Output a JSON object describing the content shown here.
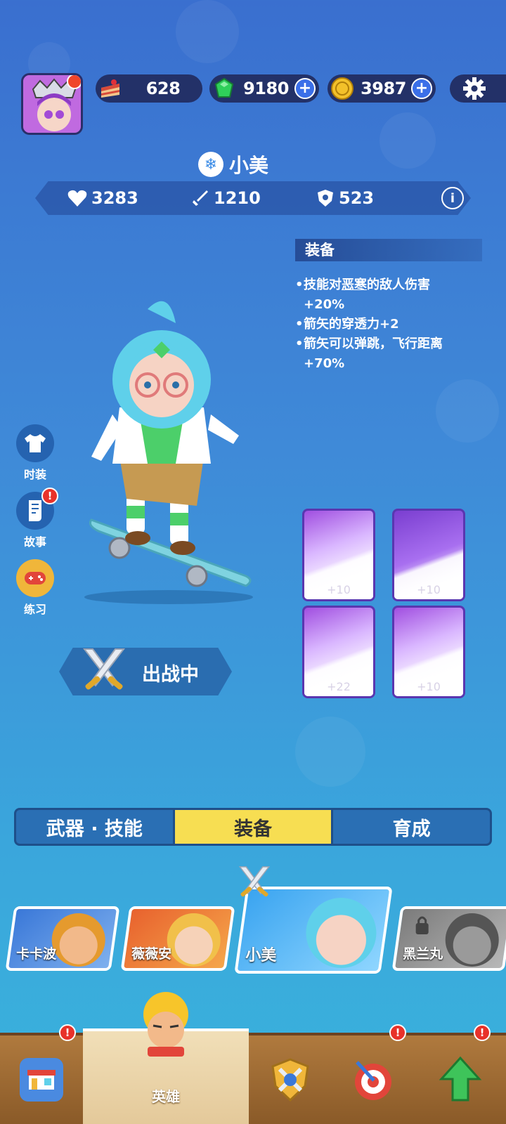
{
  "resources": {
    "cake": {
      "value": "628",
      "icon": "cake-icon"
    },
    "gem": {
      "value": "9180",
      "icon": "gem-icon"
    },
    "coin": {
      "value": "3987",
      "icon": "coin-icon"
    }
  },
  "hero": {
    "name": "小美",
    "stats": {
      "health": "3283",
      "attack": "1210",
      "defense": "523"
    }
  },
  "equipment": {
    "title": "装备",
    "desc": [
      {
        "pre": "技能对",
        "underlined": "恶寒",
        "post": "的敌人伤害"
      },
      {
        "line": "+20%"
      },
      {
        "line": "箭矢的穿透力+2"
      },
      {
        "line": "箭矢可以弹跳，飞行距离"
      },
      {
        "line": "+70%"
      }
    ],
    "cards": [
      {
        "level": "+10"
      },
      {
        "level": "+10"
      },
      {
        "level": "+22"
      },
      {
        "level": "+10"
      }
    ]
  },
  "side_menu": {
    "costume": "时装",
    "story": "故事",
    "practice": "练习",
    "badge": "!"
  },
  "battle": {
    "label": "出战中"
  },
  "tabs": [
    {
      "label": "武器 · 技能"
    },
    {
      "label": "装备"
    },
    {
      "label": "育成"
    }
  ],
  "roster": [
    {
      "name": "卡卡波"
    },
    {
      "name": "薇薇安"
    },
    {
      "name": "小美"
    },
    {
      "name": "黑兰丸"
    }
  ],
  "nav": {
    "hero": "英雄"
  },
  "colors": {
    "accent": "#f7de52",
    "badge": "#e8322a",
    "panel": "#233168"
  }
}
